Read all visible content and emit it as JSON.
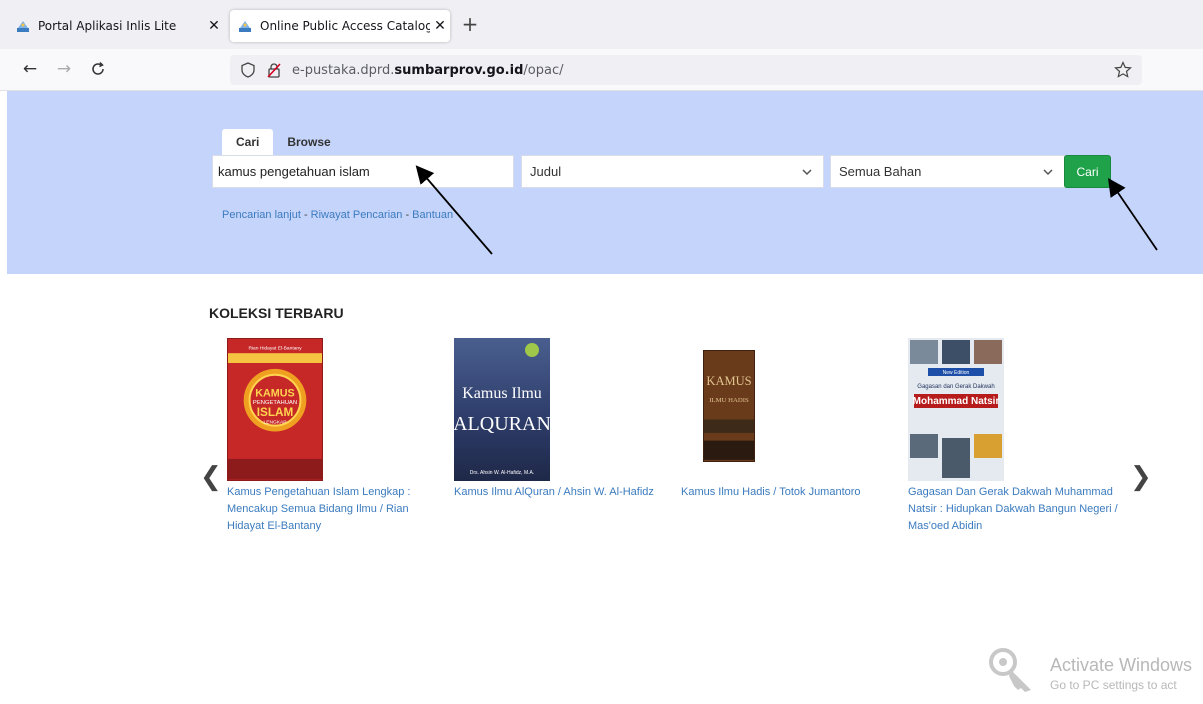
{
  "browser": {
    "tabs": [
      {
        "title": "Portal Aplikasi Inlis Lite",
        "active": false
      },
      {
        "title": "Online Public Access Catalog - I",
        "active": true
      }
    ],
    "url_prefix": "e-pustaka.dprd.",
    "url_domain": "sumbarprov.go.id",
    "url_path": "/opac/"
  },
  "search": {
    "tabs": [
      "Cari",
      "Browse"
    ],
    "query": "kamus pengetahuan islam",
    "field_select": "Judul",
    "material_select": "Semua Bahan",
    "submit_label": "Cari",
    "links": {
      "advanced": "Pencarian lanjut",
      "history": "Riwayat Pencarian",
      "help": "Bantuan",
      "separator": " - "
    }
  },
  "collection": {
    "heading": "KOLEKSI TERBARU",
    "books": [
      {
        "title": "Kamus Pengetahuan Islam Lengkap : Mencakup Semua Bidang Ilmu / Rian Hidayat El-Bantany"
      },
      {
        "title": "Kamus Ilmu AlQuran / Ahsin W. Al-Hafidz"
      },
      {
        "title": "Kamus Ilmu Hadis / Totok Jumantoro"
      },
      {
        "title": "Gagasan Dan Gerak Dakwah Muhammad Natsir : Hidupkan Dakwah Bangun Negeri / Mas'oed Abidin"
      }
    ],
    "covers": {
      "book1": {
        "header": "KAMUS",
        "sub": "PENGETAHUAN",
        "main": "ISLAM",
        "tag": "LENGKAP",
        "author": "Rian Hidayat El-Bantany"
      },
      "book2": {
        "line1": "Kamus Ilmu",
        "line2": "ALQURAN",
        "author": "Drs. Ahsin W. Al-Hafidz, M.A."
      },
      "book3": {
        "line1": "KAMUS",
        "line2": "ILMU HADIS"
      },
      "book4": {
        "line1": "Gagasan dan Gerak Dakwah",
        "line2": "Mohammad Natsir",
        "badge": "New Edition"
      }
    }
  },
  "watermark": {
    "title": "Activate Windows",
    "subtitle": "Go to PC settings to act"
  },
  "colors": {
    "hero_bg": "#c5d4fb",
    "link": "#3b7bbf",
    "button_green": "#1fa24a"
  }
}
